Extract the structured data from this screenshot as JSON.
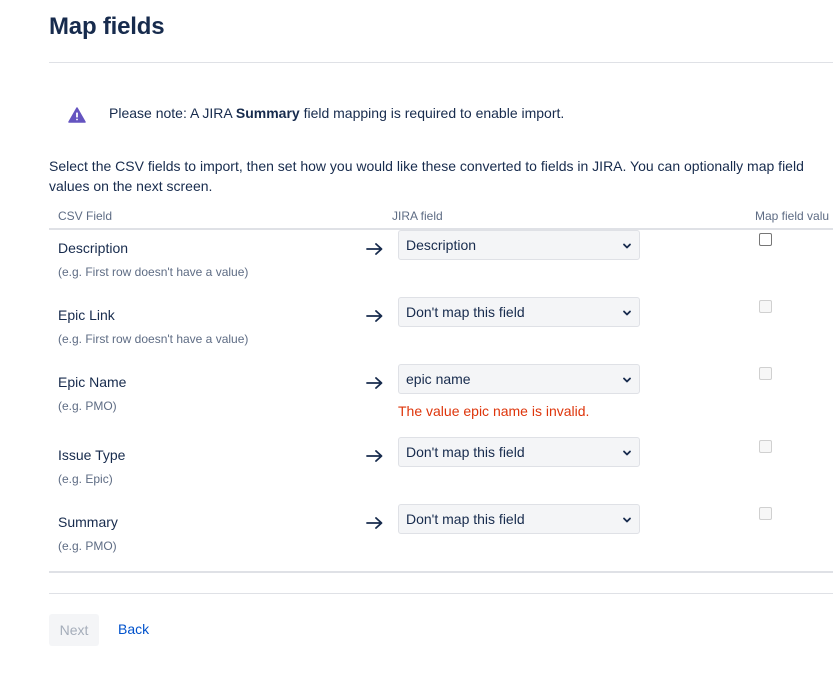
{
  "page": {
    "title": "Map fields"
  },
  "notice": {
    "icon": "warning-icon",
    "color": "#6554c0",
    "prefix": "Please note: A JIRA ",
    "emphasis": "Summary",
    "suffix": " field mapping is required to enable import."
  },
  "intro": "Select the CSV fields to import, then set how you would like these converted to fields in JIRA. You can optionally map field values on the next screen.",
  "table": {
    "headers": {
      "csv_field": "CSV Field",
      "jira_field": "JIRA field",
      "map_values": "Map field valu"
    },
    "rows": [
      {
        "name": "Description",
        "hint": "(e.g. First row doesn't have a value)",
        "mapping": "Description",
        "error": "",
        "map_values_enabled": true,
        "map_values_checked": false
      },
      {
        "name": "Epic Link",
        "hint": "(e.g. First row doesn't have a value)",
        "mapping": "Don't map this field",
        "error": "",
        "map_values_enabled": false,
        "map_values_checked": false
      },
      {
        "name": "Epic Name",
        "hint": "(e.g. PMO)",
        "mapping": "epic name",
        "error": "The value epic name is invalid.",
        "map_values_enabled": false,
        "map_values_checked": false
      },
      {
        "name": "Issue Type",
        "hint": "(e.g. Epic)",
        "mapping": "Don't map this field",
        "error": "",
        "map_values_enabled": false,
        "map_values_checked": false
      },
      {
        "name": "Summary",
        "hint": "(e.g. PMO)",
        "mapping": "Don't map this field",
        "error": "",
        "map_values_enabled": false,
        "map_values_checked": false
      }
    ]
  },
  "actions": {
    "next_label": "Next",
    "next_enabled": false,
    "back_label": "Back"
  },
  "colors": {
    "error": "#de350b",
    "link": "#0052cc",
    "text": "#172b4d"
  }
}
